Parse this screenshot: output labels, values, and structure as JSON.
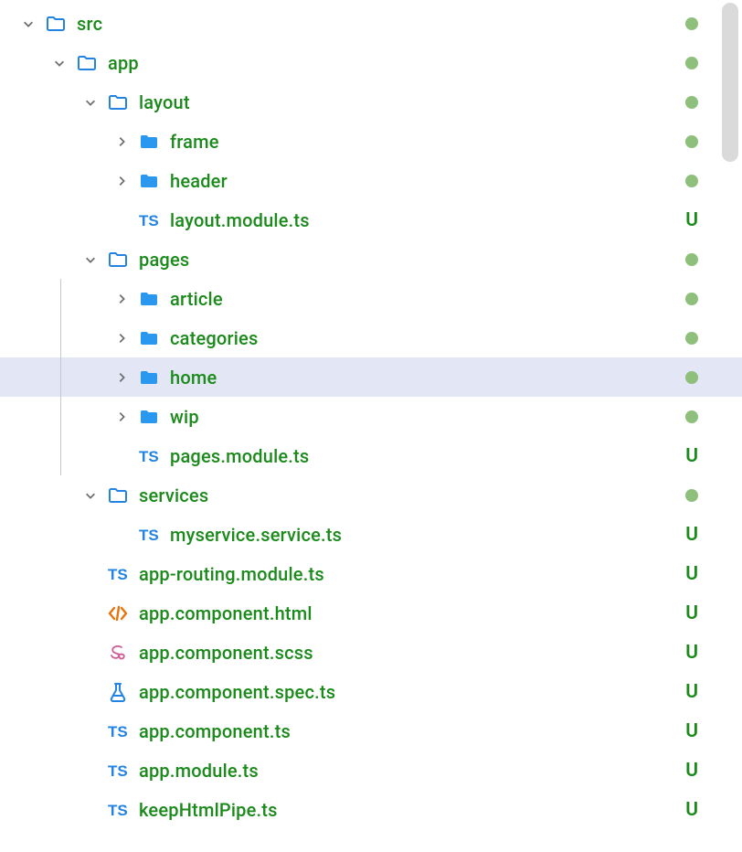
{
  "icons": {
    "folder_outline": "folder-outline",
    "folder_solid": "folder-solid",
    "ts": "ts-file",
    "html": "html-file",
    "scss": "scss-file",
    "spec": "spec-file"
  },
  "status_u": "U",
  "tree": [
    {
      "depth": 0,
      "chev": "down",
      "icon": "folder_outline",
      "label": "src",
      "status": "dot",
      "selected": false
    },
    {
      "depth": 1,
      "chev": "down",
      "icon": "folder_outline",
      "label": "app",
      "status": "dot",
      "selected": false
    },
    {
      "depth": 2,
      "chev": "down",
      "icon": "folder_outline",
      "label": "layout",
      "status": "dot",
      "selected": false
    },
    {
      "depth": 3,
      "chev": "right",
      "icon": "folder_solid",
      "label": "frame",
      "status": "dot",
      "selected": false
    },
    {
      "depth": 3,
      "chev": "right",
      "icon": "folder_solid",
      "label": "header",
      "status": "dot",
      "selected": false
    },
    {
      "depth": 3,
      "chev": null,
      "icon": "ts",
      "label": "layout.module.ts",
      "status": "U",
      "selected": false
    },
    {
      "depth": 2,
      "chev": "down",
      "icon": "folder_outline",
      "label": "pages",
      "status": "dot",
      "selected": false
    },
    {
      "depth": 3,
      "chev": "right",
      "icon": "folder_solid",
      "label": "article",
      "status": "dot",
      "selected": false,
      "guide": true
    },
    {
      "depth": 3,
      "chev": "right",
      "icon": "folder_solid",
      "label": "categories",
      "status": "dot",
      "selected": false,
      "guide": true
    },
    {
      "depth": 3,
      "chev": "right",
      "icon": "folder_solid",
      "label": "home",
      "status": "dot",
      "selected": true,
      "guide": true
    },
    {
      "depth": 3,
      "chev": "right",
      "icon": "folder_solid",
      "label": "wip",
      "status": "dot",
      "selected": false,
      "guide": true
    },
    {
      "depth": 3,
      "chev": null,
      "icon": "ts",
      "label": "pages.module.ts",
      "status": "U",
      "selected": false,
      "guide": true
    },
    {
      "depth": 2,
      "chev": "down",
      "icon": "folder_outline",
      "label": "services",
      "status": "dot",
      "selected": false
    },
    {
      "depth": 3,
      "chev": null,
      "icon": "ts",
      "label": "myservice.service.ts",
      "status": "U",
      "selected": false
    },
    {
      "depth": 2,
      "chev": null,
      "icon": "ts",
      "label": "app-routing.module.ts",
      "status": "U",
      "selected": false
    },
    {
      "depth": 2,
      "chev": null,
      "icon": "html",
      "label": "app.component.html",
      "status": "U",
      "selected": false
    },
    {
      "depth": 2,
      "chev": null,
      "icon": "scss",
      "label": "app.component.scss",
      "status": "U",
      "selected": false
    },
    {
      "depth": 2,
      "chev": null,
      "icon": "spec",
      "label": "app.component.spec.ts",
      "status": "U",
      "selected": false
    },
    {
      "depth": 2,
      "chev": null,
      "icon": "ts",
      "label": "app.component.ts",
      "status": "U",
      "selected": false
    },
    {
      "depth": 2,
      "chev": null,
      "icon": "ts",
      "label": "app.module.ts",
      "status": "U",
      "selected": false
    },
    {
      "depth": 2,
      "chev": null,
      "icon": "ts",
      "label": "keepHtmlPipe.ts",
      "status": "U",
      "selected": false
    }
  ]
}
